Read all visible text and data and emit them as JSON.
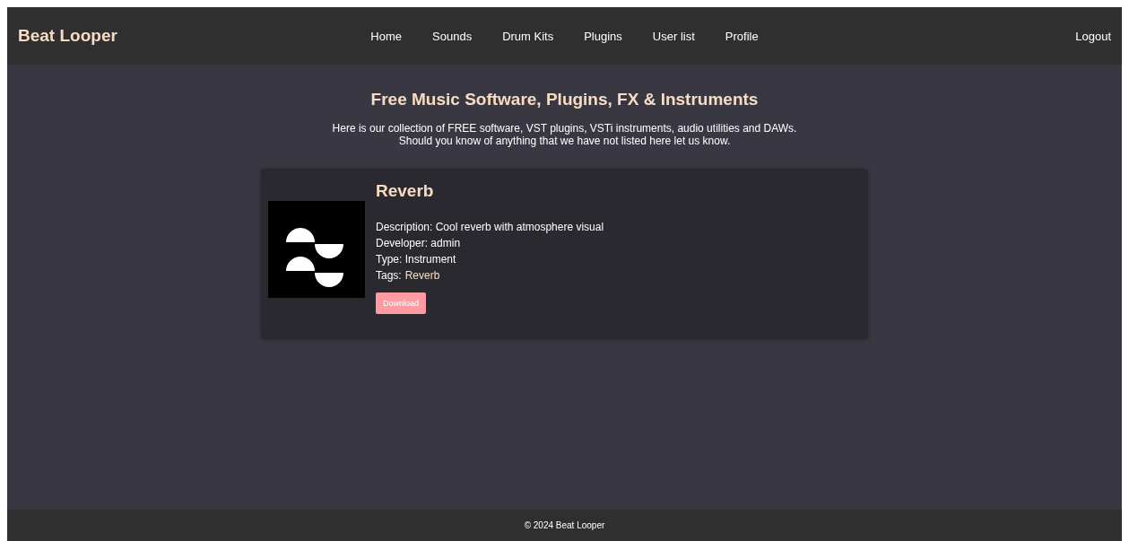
{
  "navbar": {
    "brand": "Beat Looper",
    "links": [
      {
        "label": "Home"
      },
      {
        "label": "Sounds"
      },
      {
        "label": "Drum Kits"
      },
      {
        "label": "Plugins"
      },
      {
        "label": "User list"
      },
      {
        "label": "Profile"
      }
    ],
    "logout": "Logout"
  },
  "header": {
    "title": "Free Music Software, Plugins, FX & Instruments",
    "intro": [
      "Here is our collection of FREE software, VST plugins, VSTi instruments, audio utilities and DAWs.",
      "Should you know of anything that we have not listed here let us know."
    ]
  },
  "plugins": [
    {
      "name": "Reverb",
      "description": "Description: Cool reverb with atmosphere visual",
      "developer": "Developer: admin",
      "type": "Type: Instrument",
      "tags_label": "Tags:",
      "tags": [
        "Reverb"
      ],
      "button": "Download"
    }
  ],
  "footer": "© 2024 Beat Looper"
}
